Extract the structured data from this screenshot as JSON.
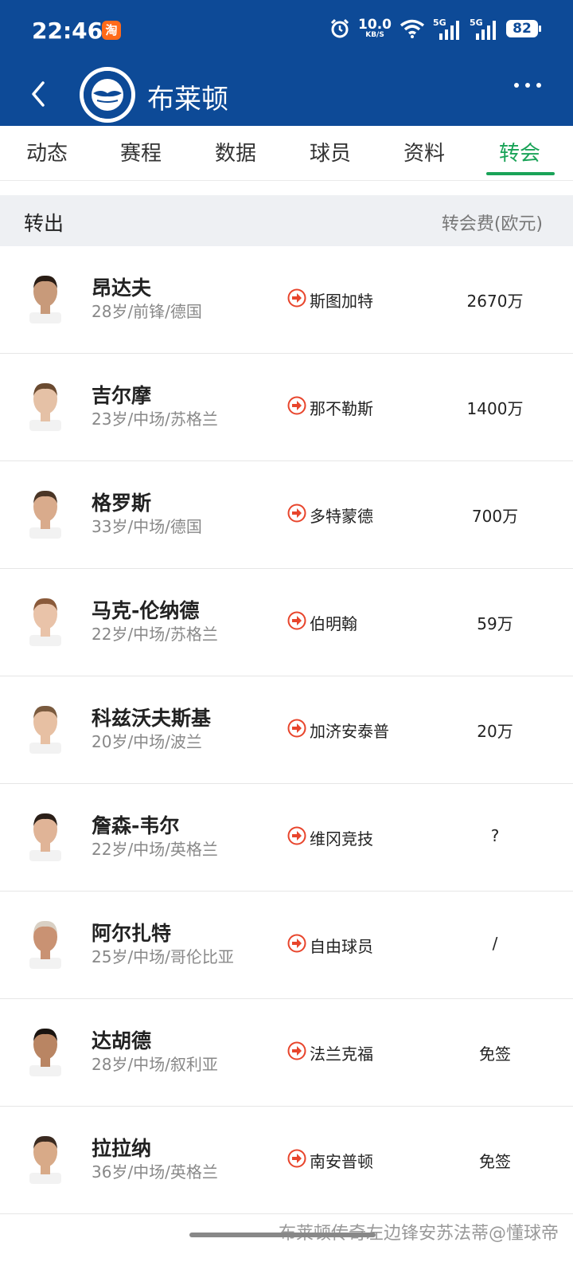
{
  "status_bar": {
    "time": "22:46",
    "app_badge": "淘",
    "net_speed": "10.0",
    "net_unit": "KB/S",
    "signal1": "5G",
    "signal2": "5G",
    "battery": "82"
  },
  "header": {
    "team_name": "布莱顿",
    "crest_icon": "brighton-crest"
  },
  "tabs": [
    "动态",
    "赛程",
    "数据",
    "球员",
    "资料",
    "转会"
  ],
  "active_tab": "转会",
  "section": {
    "title": "转出",
    "fee_header": "转会费(欧元)"
  },
  "transfers": [
    {
      "name": "昂达夫",
      "info": "28岁/前锋/德国",
      "club": "斯图加特",
      "fee": "2670万"
    },
    {
      "name": "吉尔摩",
      "info": "23岁/中场/苏格兰",
      "club": "那不勒斯",
      "fee": "1400万"
    },
    {
      "name": "格罗斯",
      "info": "33岁/中场/德国",
      "club": "多特蒙德",
      "fee": "700万"
    },
    {
      "name": "马克-伦纳德",
      "info": "22岁/中场/苏格兰",
      "club": "伯明翰",
      "fee": "59万"
    },
    {
      "name": "科兹沃夫斯基",
      "info": "20岁/中场/波兰",
      "club": "加济安泰普",
      "fee": "20万"
    },
    {
      "name": "詹森-韦尔",
      "info": "22岁/中场/英格兰",
      "club": "维冈竞技",
      "fee": "?"
    },
    {
      "name": "阿尔扎特",
      "info": "25岁/中场/哥伦比亚",
      "club": "自由球员",
      "fee": "/"
    },
    {
      "name": "达胡德",
      "info": "28岁/中场/叙利亚",
      "club": "法兰克福",
      "fee": "免签"
    },
    {
      "name": "拉拉纳",
      "info": "36岁/中场/英格兰",
      "club": "南安普顿",
      "fee": "免签"
    }
  ],
  "colors": {
    "header_bg": "#0d4a97",
    "accent_green": "#1aa358",
    "arrow_red": "#e8452c",
    "section_bg": "#eef0f3"
  },
  "watermark": "布莱顿传奇左边锋安苏法蒂@懂球帝"
}
